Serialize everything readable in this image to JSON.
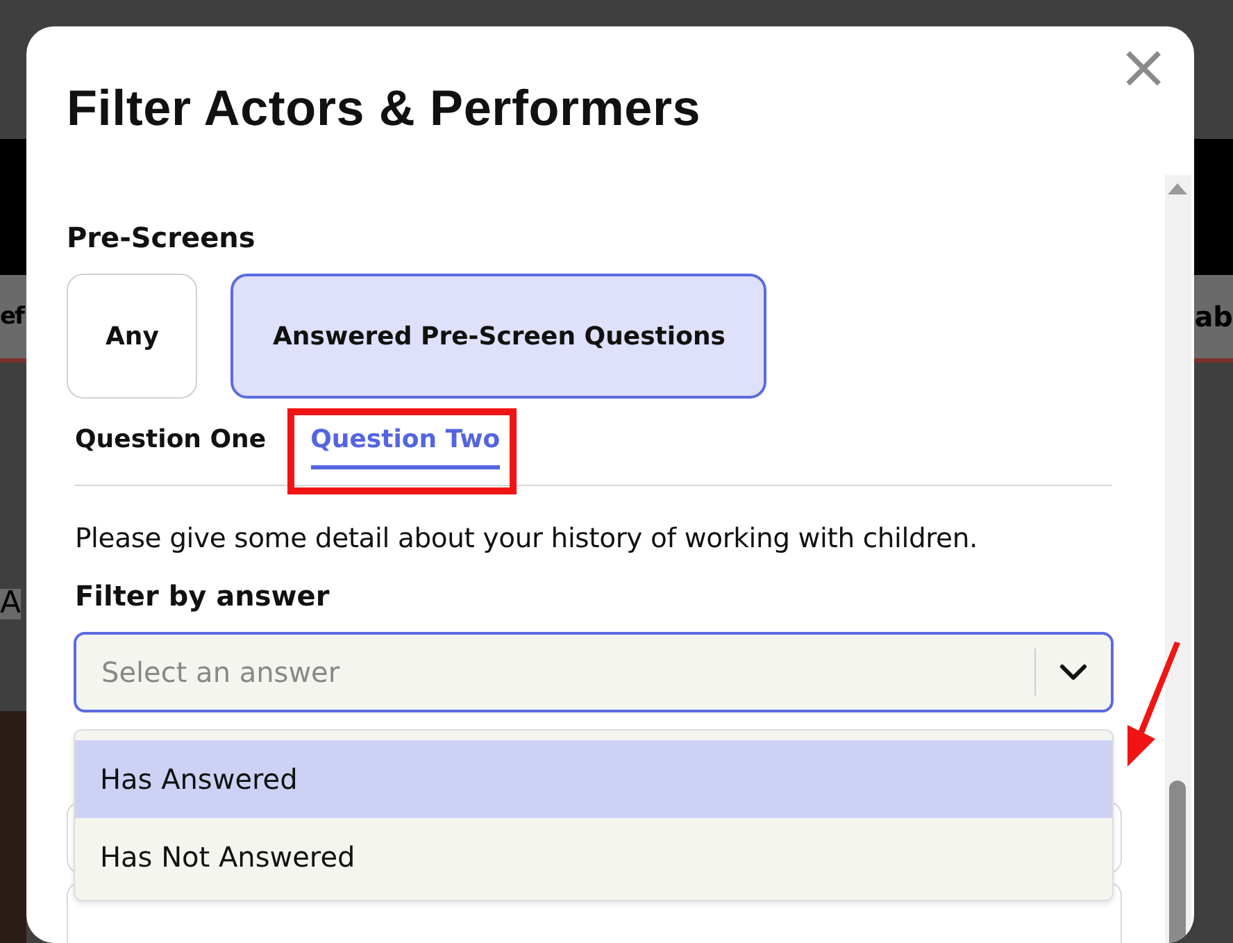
{
  "background_fragments": [
    {
      "kind": "left",
      "text": "ef"
    },
    {
      "kind": "right",
      "text": "ab"
    },
    {
      "kind": "lower-left",
      "text": "A"
    }
  ],
  "dialog": {
    "title": "Filter Actors & Performers",
    "close_icon": "×"
  },
  "pre_screens": {
    "label": "Pre-Screens",
    "options": [
      {
        "label": "Any",
        "selected": false
      },
      {
        "label": "Answered Pre-Screen Questions",
        "selected": true
      }
    ]
  },
  "tabs": [
    {
      "label": "Question One",
      "selected": false
    },
    {
      "label": "Question Two",
      "selected": true
    }
  ],
  "question_text": "Please give some detail about your history of working with children.",
  "filter": {
    "label": "Filter by answer",
    "placeholder": "Select an answer",
    "expanded": true,
    "options": [
      {
        "label": "Has Answered",
        "selected": true
      },
      {
        "label": "Has Not Answered",
        "selected": false
      }
    ]
  }
}
